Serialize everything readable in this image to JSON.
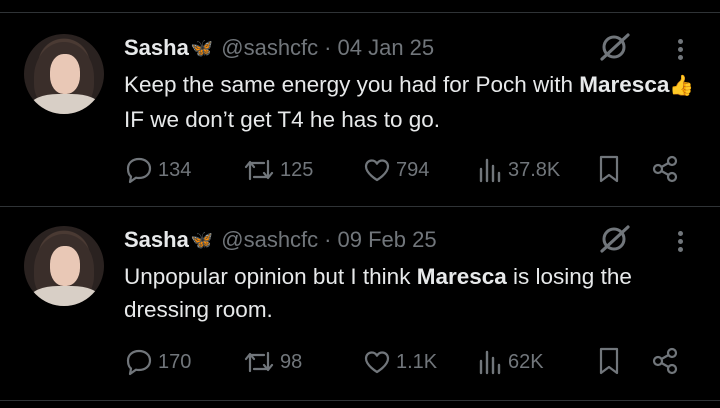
{
  "tweets": [
    {
      "name": "Sasha",
      "emoji": "🦋",
      "handle": "@sashcfc",
      "separator": "·",
      "date": "04 Jan 25",
      "text_parts": [
        "Keep the same energy you had for Poch with ",
        "Maresca",
        "👍",
        " IF we don’t get T4 he has to go."
      ],
      "replies": "134",
      "reposts": "125",
      "likes": "794",
      "views": "37.8K"
    },
    {
      "name": "Sasha",
      "emoji": "🦋",
      "handle": "@sashcfc",
      "separator": "·",
      "date": "09 Feb 25",
      "text_parts": [
        "Unpopular opinion but I think ",
        "Maresca",
        " is losing the dressing room."
      ],
      "replies": "170",
      "reposts": "98",
      "likes": "1.1K",
      "views": "62K"
    }
  ],
  "icons": [
    "grok-icon",
    "more-icon",
    "reply-icon",
    "repost-icon",
    "like-icon",
    "views-icon",
    "bookmark-icon",
    "share-icon"
  ],
  "colors": {
    "background": "#000000",
    "text": "#e7e9ea",
    "muted": "#71767b",
    "divider": "#2f3336"
  }
}
